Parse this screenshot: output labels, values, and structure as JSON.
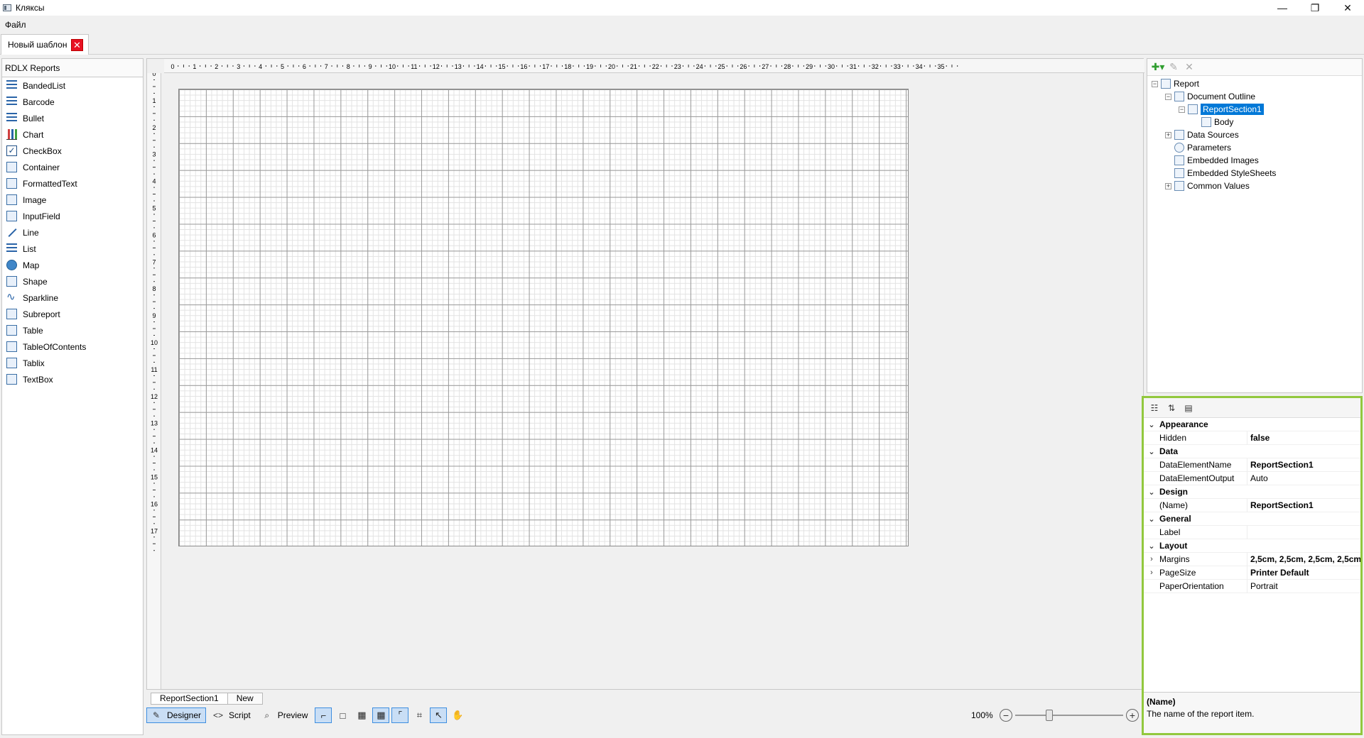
{
  "window": {
    "title": "Кляксы",
    "buttons": [
      "—",
      "❐",
      "✕"
    ]
  },
  "menu": [
    "Файл"
  ],
  "doc_tab": {
    "label": "Новый шаблон",
    "close": "✕"
  },
  "toolbox": {
    "header": "RDLX Reports",
    "items": [
      "BandedList",
      "Barcode",
      "Bullet",
      "Chart",
      "CheckBox",
      "Container",
      "FormattedText",
      "Image",
      "InputField",
      "Line",
      "List",
      "Map",
      "Shape",
      "Sparkline",
      "Subreport",
      "Table",
      "TableOfContents",
      "Tablix",
      "TextBox"
    ]
  },
  "ruler_h": [
    "0",
    "1",
    "2",
    "3",
    "4",
    "5",
    "6",
    "7",
    "8",
    "9",
    "10",
    "11",
    "12",
    "13",
    "14",
    "15",
    "16",
    "17",
    "18",
    "19",
    "20",
    "21",
    "22",
    "23",
    "24",
    "25",
    "26",
    "27",
    "28",
    "29",
    "30",
    "31",
    "32",
    "33",
    "34",
    "35"
  ],
  "ruler_v": [
    "0",
    "1",
    "2",
    "3",
    "4",
    "5",
    "6",
    "7",
    "8",
    "9",
    "10",
    "11",
    "12",
    "13",
    "14",
    "15",
    "16",
    "17"
  ],
  "section_tabs": [
    "ReportSection1",
    "New"
  ],
  "bottom": {
    "designer": "Designer",
    "script": "Script",
    "preview": "Preview",
    "zoom": "100%",
    "zoom_level": 0.3
  },
  "outline": {
    "report": "Report",
    "document_outline": "Document Outline",
    "report_section": "ReportSection1",
    "body": "Body",
    "data_sources": "Data Sources",
    "parameters": "Parameters",
    "embedded_images": "Embedded Images",
    "embedded_stylesheets": "Embedded StyleSheets",
    "common_values": "Common Values"
  },
  "properties": {
    "rows": [
      {
        "type": "cat",
        "name": "Appearance"
      },
      {
        "type": "prop",
        "name": "Hidden",
        "value": "false",
        "bold": true
      },
      {
        "type": "cat",
        "name": "Data"
      },
      {
        "type": "prop",
        "name": "DataElementName",
        "value": "ReportSection1",
        "bold": true
      },
      {
        "type": "prop",
        "name": "DataElementOutput",
        "value": "Auto",
        "bold": false
      },
      {
        "type": "cat",
        "name": "Design"
      },
      {
        "type": "prop",
        "name": "(Name)",
        "value": "ReportSection1",
        "bold": true
      },
      {
        "type": "cat",
        "name": "General"
      },
      {
        "type": "prop",
        "name": "Label",
        "value": "",
        "bold": false
      },
      {
        "type": "cat",
        "name": "Layout"
      },
      {
        "type": "prop",
        "name": "Margins",
        "value": "2,5cm, 2,5cm, 2,5cm, 2,5cm",
        "bold": true,
        "expand": true
      },
      {
        "type": "prop",
        "name": "PageSize",
        "value": "Printer Default",
        "bold": true,
        "expand": true
      },
      {
        "type": "prop",
        "name": "PaperOrientation",
        "value": "Portrait",
        "bold": false
      }
    ],
    "desc_title": "(Name)",
    "desc_text": "The name of the report item."
  }
}
